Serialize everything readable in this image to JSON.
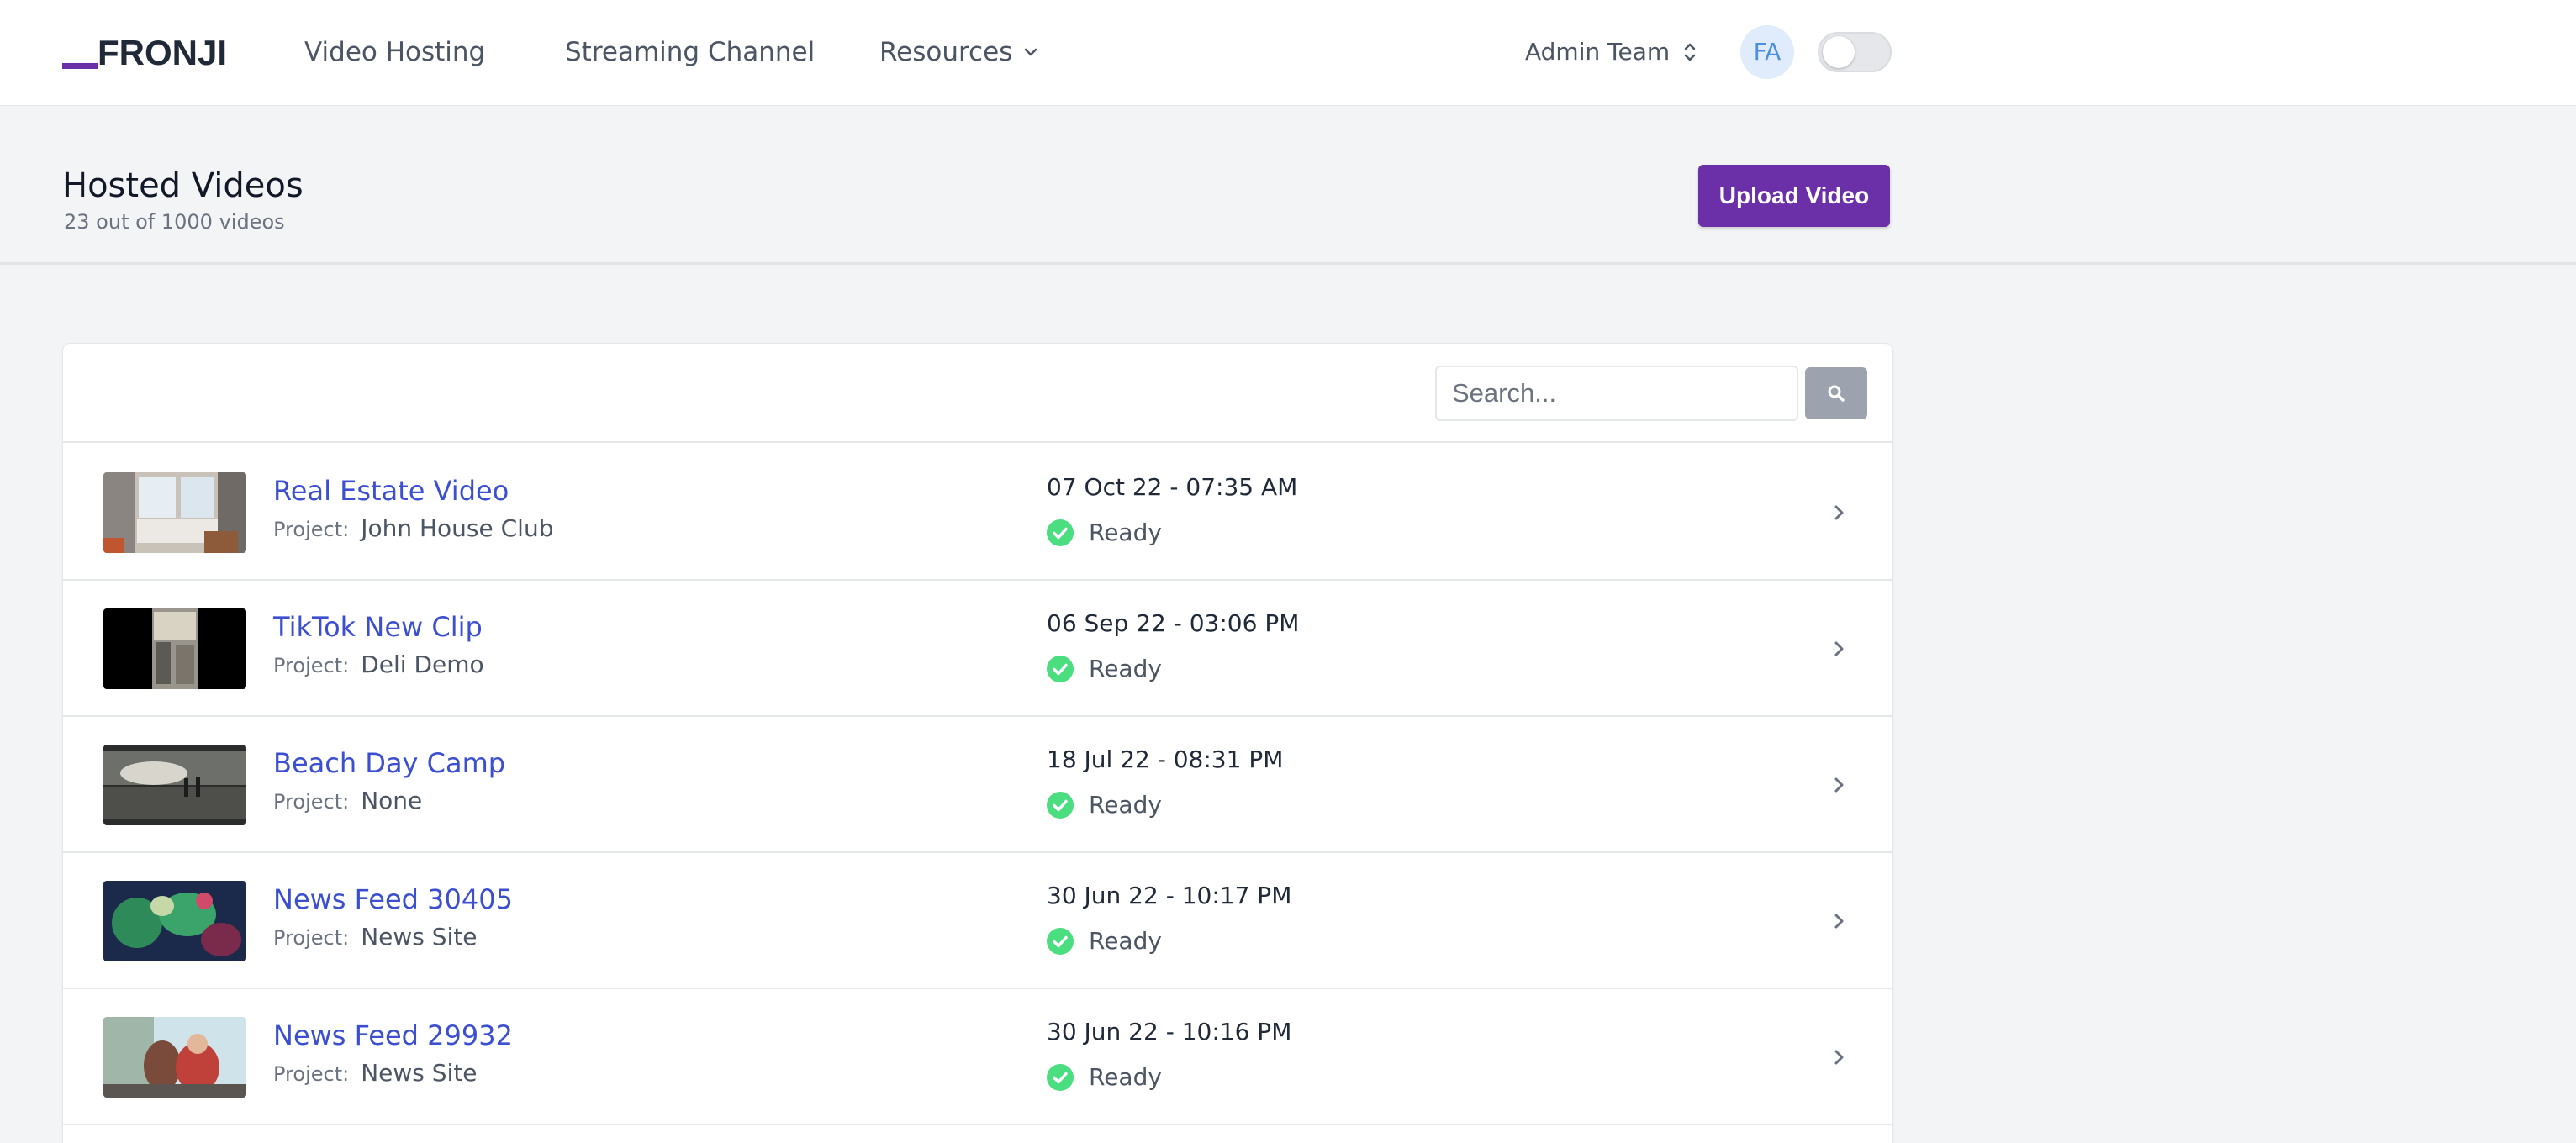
{
  "app": {
    "logo_text": "FRONJI",
    "accent_color": "#6b2fa8",
    "link_color": "#3b4fd0",
    "status_color": "#4ade80"
  },
  "nav": {
    "items": [
      {
        "label": "Video Hosting"
      },
      {
        "label": "Streaming Channel"
      },
      {
        "label": "Resources",
        "icon": "chevron-down-icon"
      }
    ],
    "team_label": "Admin Team",
    "avatar_initials": "FA",
    "theme_toggle_on": false
  },
  "header": {
    "title": "Hosted Videos",
    "subtitle": "23 out of 1000 videos",
    "upload_label": "Upload Video"
  },
  "search": {
    "placeholder": "Search...",
    "icon": "search-icon"
  },
  "videos": [
    {
      "title": "Real Estate Video",
      "project_label": "Project:",
      "project": "John House Club",
      "date": "07 Oct 22 - 07:35 AM",
      "status": "Ready"
    },
    {
      "title": "TikTok New Clip",
      "project_label": "Project:",
      "project": "Deli Demo",
      "date": "06 Sep 22 - 03:06 PM",
      "status": "Ready"
    },
    {
      "title": "Beach Day Camp",
      "project_label": "Project:",
      "project": "None",
      "date": "18 Jul 22 - 08:31 PM",
      "status": "Ready"
    },
    {
      "title": "News Feed 30405",
      "project_label": "Project:",
      "project": "News Site",
      "date": "30 Jun 22 - 10:17 PM",
      "status": "Ready"
    },
    {
      "title": "News Feed 29932",
      "project_label": "Project:",
      "project": "News Site",
      "date": "30 Jun 22 - 10:16 PM",
      "status": "Ready"
    }
  ]
}
